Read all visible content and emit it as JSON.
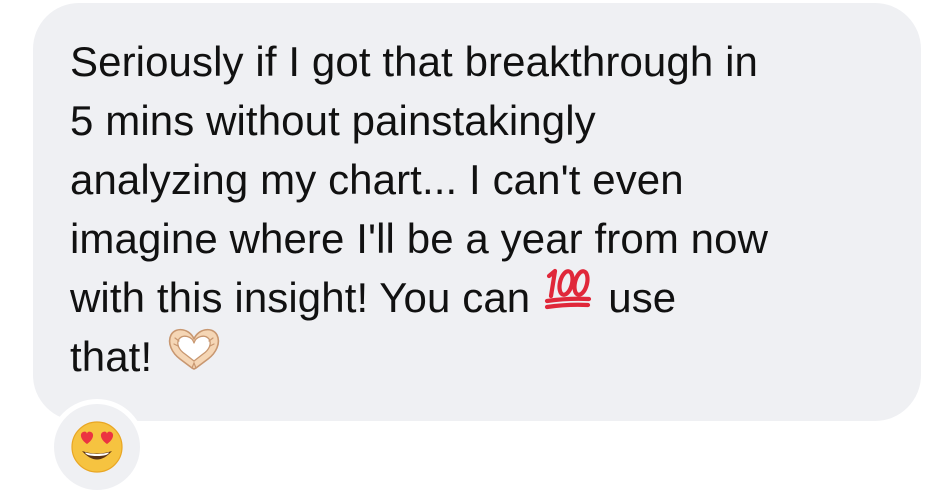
{
  "message": {
    "line1": "Seriously if I got that breakthrough in",
    "line2": "5 mins without painstakingly",
    "line3": "analyzing my chart... I can't even",
    "line4": "imagine where I'll be a year from now",
    "line5_before": "with this insight! You can",
    "line5_emoji": "hundred-points-icon",
    "line5_after": "use",
    "line6_text": "that!",
    "line6_emoji": "heart-hands-icon"
  },
  "reaction": {
    "emoji": "smiling-face-with-heart-eyes-icon"
  },
  "colors": {
    "bubble": "#eff0f3",
    "text": "#111111",
    "hundred_red": "#e0283a",
    "emoji_yellow": "#f6c340",
    "heart_red": "#ec3341"
  }
}
